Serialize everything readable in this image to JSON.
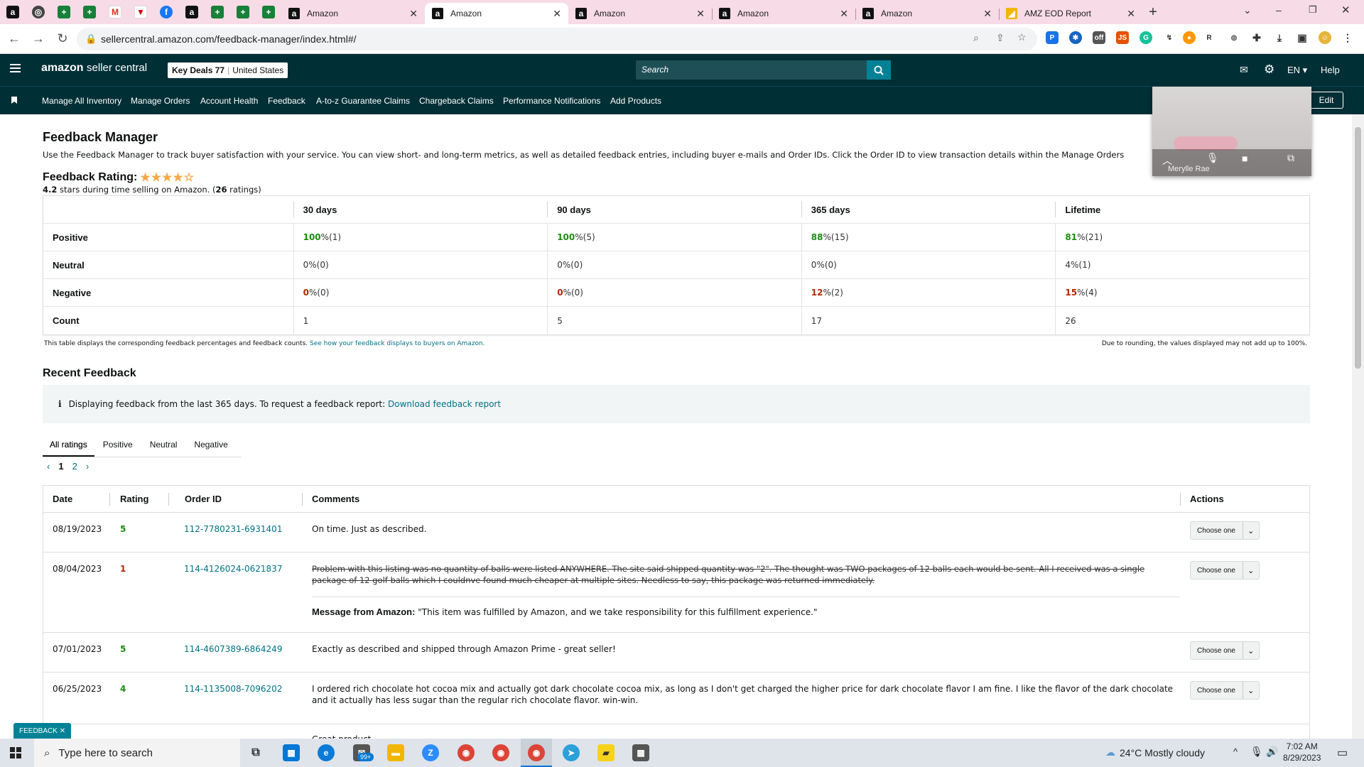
{
  "browser": {
    "tabs": [
      {
        "label": "Amazon"
      },
      {
        "label": "Amazon"
      },
      {
        "label": "Amazon"
      },
      {
        "label": "Amazon"
      },
      {
        "label": "Amazon"
      },
      {
        "label": "AMZ EOD Report"
      }
    ],
    "url": "sellercentral.amazon.com/feedback-manager/index.html#/"
  },
  "header": {
    "logo_brand": "amazon",
    "logo_suffix": "seller central",
    "account_store": "Key Deals 77",
    "account_region": "United States",
    "search_placeholder": "Search",
    "language": "EN",
    "help": "Help"
  },
  "nav": {
    "items": [
      "Manage All Inventory",
      "Manage Orders",
      "Account Health",
      "Feedback",
      "A-to-z Guarantee Claims",
      "Chargeback Claims",
      "Performance Notifications",
      "Add Products"
    ],
    "edit": "Edit"
  },
  "video_overlay": {
    "name": "Merylle Rae"
  },
  "page": {
    "title": "Feedback Manager",
    "description": "Use the Feedback Manager to track buyer satisfaction with your service. You can view short- and long-term metrics, as well as detailed feedback entries, including buyer e-mails and Order IDs. Click the Order ID to view transaction details within the Manage Orders",
    "rating_label": "Feedback Rating:",
    "stars": 4.2,
    "rating_value": "4.2",
    "rating_text_mid": " stars during time selling on Amazon. (",
    "rating_count": "26",
    "rating_text_end": " ratings)"
  },
  "metrics": {
    "columns": [
      "30 days",
      "90 days",
      "365 days",
      "Lifetime"
    ],
    "rows": [
      {
        "label": "Positive",
        "class": "green",
        "cells": [
          [
            "100",
            " %(1)"
          ],
          [
            "100",
            " %(5)"
          ],
          [
            "88",
            " %(15)"
          ],
          [
            "81",
            " %(21)"
          ]
        ]
      },
      {
        "label": "Neutral",
        "class": "",
        "cells": [
          [
            "0",
            " %(0)"
          ],
          [
            "0",
            " %(0)"
          ],
          [
            "0",
            " %(0)"
          ],
          [
            "4",
            " %(1)"
          ]
        ]
      },
      {
        "label": "Negative",
        "class": "red",
        "cells": [
          [
            "0",
            " %(0)"
          ],
          [
            "0",
            " %(0)"
          ],
          [
            "12",
            " %(2)"
          ],
          [
            "15",
            " %(4)"
          ]
        ]
      },
      {
        "label": "Count",
        "class": "",
        "cells": [
          [
            "",
            "1"
          ],
          [
            "",
            "5"
          ],
          [
            "",
            "17"
          ],
          [
            "",
            "26"
          ]
        ]
      }
    ],
    "footnote": "This table displays the corresponding feedback percentages and feedback counts.",
    "footnote_link": "See how your feedback displays to buyers on Amazon.",
    "rounding_note": "Due to rounding, the values displayed may not add up to 100%."
  },
  "recent": {
    "title": "Recent Feedback",
    "info_text": "Displaying feedback from the last 365 days. To request a feedback report:",
    "info_link": "Download feedback report",
    "filters": [
      "All ratings",
      "Positive",
      "Neutral",
      "Negative"
    ],
    "pages": [
      "1",
      "2"
    ],
    "columns": {
      "date": "Date",
      "rating": "Rating",
      "order_id": "Order ID",
      "comments": "Comments",
      "actions": "Actions"
    },
    "choose_label": "Choose one",
    "rows": [
      {
        "date": "08/19/2023",
        "rating": "5",
        "order": "112-7780231-6931401",
        "comment": "On time. Just as described."
      },
      {
        "date": "08/04/2023",
        "rating": "1",
        "order": "114-4126024-0621837",
        "comment": "Problem with this listing was no quantity of balls were listed ANYWHERE. The site said shipped quantity was \"2\". The thought was TWO packages of 12 balls each would be sent. All I received was a single package of 12 golf balls which I couldnve found much cheaper at multiple sites. Needless to say, this package was returned immediately.",
        "msg_label": "Message from Amazon:",
        "msg": " \"This item was fulfilled by Amazon, and we take responsibility for this fulfillment experience.\""
      },
      {
        "date": "07/01/2023",
        "rating": "5",
        "order": "114-4607389-6864249",
        "comment": "Exactly as described and shipped through Amazon Prime - great seller!"
      },
      {
        "date": "06/25/2023",
        "rating": "4",
        "order": "114-1135008-7096202",
        "comment": "I ordered rich chocolate hot cocoa mix and actually got dark chocolate cocoa mix, as long as I don't get charged the higher price for dark chocolate flavor I am fine. I like the flavor of the dark chocolate and it actually has less sugar than the regular rich chocolate flavor. win-win."
      },
      {
        "date": "",
        "rating": "",
        "order": "",
        "comment": "Great product"
      }
    ]
  },
  "feedback_tab": "FEEDBACK",
  "taskbar": {
    "search_placeholder": "Type here to search",
    "badge": "99+",
    "weather": "24°C  Mostly cloudy",
    "time": "7:02 AM",
    "date": "8/29/2023"
  },
  "colors": {
    "header_bg": "#002f36",
    "teal": "#007185",
    "green": "#1a8d0f",
    "red": "#b12704",
    "tab_strip": "#f7dbe6"
  }
}
